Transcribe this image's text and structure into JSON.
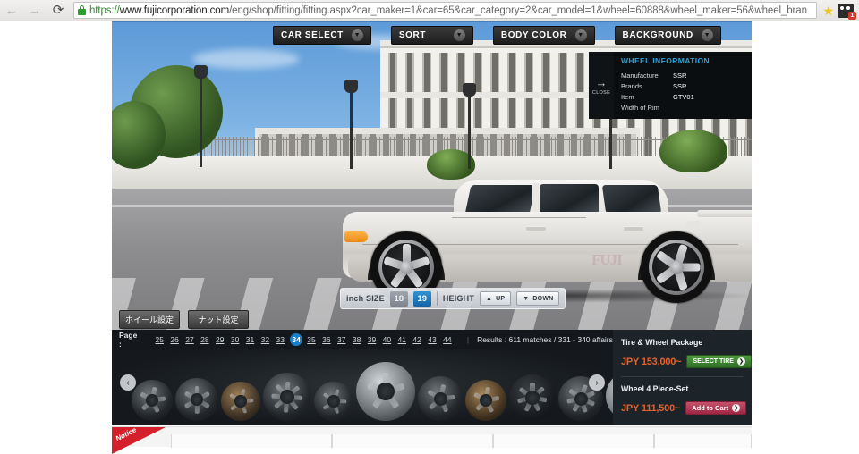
{
  "browser": {
    "back_icon": "back-arrow-icon",
    "forward_icon": "forward-arrow-icon",
    "reload_icon": "reload-icon",
    "lock_icon": "lock-icon",
    "url_scheme": "https://",
    "url_host": "www.fujicorporation.com",
    "url_path": "/eng/shop/fitting/fitting.aspx?car_maker=1&car=65&car_category=2&car_model=1&wheel=60888&wheel_maker=56&wheel_bran",
    "star_icon": "★",
    "extension_badge": "1"
  },
  "toolbar": {
    "buttons": [
      {
        "label": "CAR SELECT",
        "icon": "chevron-down-icon"
      },
      {
        "label": "SORT",
        "icon": "chevron-down-icon"
      },
      {
        "label": "BODY COLOR",
        "icon": "chevron-down-icon"
      },
      {
        "label": "BACKGROUND",
        "icon": "chevron-down-icon"
      }
    ]
  },
  "wheel_information": {
    "close_label": "CLOSE",
    "close_arrow": "→",
    "title": "WHEEL INFORMATION",
    "rows": [
      {
        "key": "Manufacture",
        "value": "SSR"
      },
      {
        "key": "Brands",
        "value": "SSR"
      },
      {
        "key": "Item",
        "value": "GTV01"
      },
      {
        "key": "Width of Rim",
        "value": ""
      }
    ]
  },
  "size_bar": {
    "inch_label": "inch SIZE",
    "sizes": [
      {
        "label": "18",
        "active": false
      },
      {
        "label": "19",
        "active": true
      }
    ],
    "height_label": "HEIGHT",
    "up_label": "UP",
    "up_icon": "▲",
    "down_label": "DOWN",
    "down_icon": "▼"
  },
  "jp_buttons": [
    {
      "label": "ホイール設定"
    },
    {
      "label": "ナット設定"
    }
  ],
  "pager": {
    "label": "Page :",
    "pages": [
      "25",
      "26",
      "27",
      "28",
      "29",
      "30",
      "31",
      "32",
      "33",
      "34",
      "35",
      "36",
      "37",
      "38",
      "39",
      "40",
      "41",
      "42",
      "43",
      "44"
    ],
    "active_page": "34",
    "separator": "|",
    "results": "Results : 611 matches / 331 - 340 affairs"
  },
  "carousel": {
    "prev_icon": "‹",
    "next_icon": "›"
  },
  "side_panel": {
    "package_title": "Tire & Wheel Package",
    "package_price": "JPY 153,000~",
    "package_button": "SELECT TIRE",
    "package_button_icon": "❯",
    "set_title": "Wheel 4 Piece-Set",
    "set_price": "JPY 111,500~",
    "set_button": "Add to Cart",
    "set_button_icon": "❯"
  },
  "notice": {
    "label": "Notice"
  },
  "colors": {
    "accent_blue": "#1a7fc6",
    "info_blue": "#2f9fd8",
    "price_orange": "#e2622f",
    "green_button": "#4e9a3e",
    "red_button": "#c4516a",
    "notice_red": "#d3202a"
  }
}
